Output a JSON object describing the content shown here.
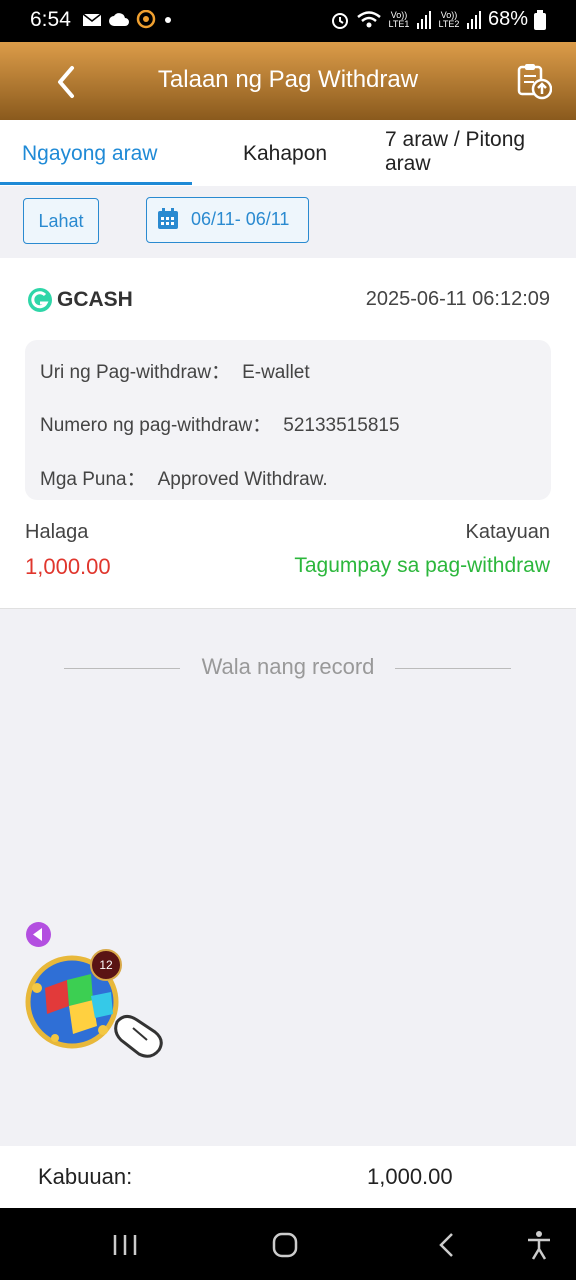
{
  "status_bar": {
    "time": "6:54",
    "signal_label_1": "Vo)) LTE1",
    "signal_label_2": "Vo)) LTE2",
    "battery": "68%",
    "icons": [
      "mail-icon",
      "cloud-icon",
      "chat-icon",
      "dot-icon",
      "alarm-icon",
      "wifi-icon",
      "signal-icon",
      "battery-icon"
    ]
  },
  "header": {
    "title": "Talaan ng Pag Withdraw",
    "back_icon": "back-arrow-icon",
    "action_icon": "clipboard-upload-icon",
    "gradient": [
      "#dc9c49",
      "#8a5a1d"
    ]
  },
  "tabs": [
    {
      "label": "Ngayong araw",
      "active": true
    },
    {
      "label": "Kahapon",
      "active": false
    },
    {
      "label": "7 araw / Pitong araw",
      "active": false
    }
  ],
  "filters": {
    "all_label": "Lahat",
    "date_range": "06/11- 06/11"
  },
  "record": {
    "provider": "GCASH",
    "datetime": "2025-06-11 06:12:09",
    "details": [
      {
        "key": "Uri ng Pag-withdraw：",
        "value": "E-wallet"
      },
      {
        "key": "Numero ng pag-withdraw：",
        "value": "52133515815"
      },
      {
        "key": "Mga Puna：",
        "value": "Approved Withdraw."
      }
    ],
    "amount_label": "Halaga",
    "amount": "1,000.00",
    "status_label": "Katayuan",
    "status": "Tagumpay sa pag-withdraw",
    "colors": {
      "amount": "#e0362d",
      "status": "#2cb73c",
      "accent": "#1f8ad6"
    }
  },
  "no_more": "Wala nang record",
  "floating": {
    "badge": "12",
    "icons": [
      "collapse-arrow-icon",
      "game-cubes-icon",
      "pointer-hand-icon"
    ]
  },
  "footer": {
    "label": "Kabuuan:",
    "total": "1,000.00"
  },
  "system_nav": [
    "recents-icon",
    "home-icon",
    "back-icon",
    "accessibility-icon"
  ]
}
